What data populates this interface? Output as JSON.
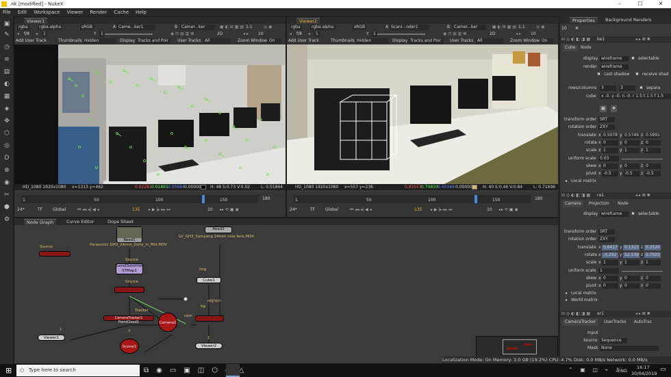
{
  "window": {
    "title": ".nk [modified] - NukeX",
    "minimize": "–",
    "maximize": "☐",
    "close": "✕"
  },
  "menu": [
    "File",
    "Edit",
    "Workspace",
    "Viewer",
    "Render",
    "Cache",
    "Help"
  ],
  "viewer1": {
    "tab": "Viewer1",
    "channels": "rgba",
    "alpha": "rgba.alpha",
    "colorspace": "sRGB",
    "a_label": "A",
    "a_input": "Came...ker1",
    "b_label": "B",
    "b_input": "Camer...ker",
    "fstop": "f/8",
    "frame": "1",
    "y": "Y",
    "y_val": "1",
    "ratio": "1:1",
    "mode": "2D",
    "zoom": "10",
    "add_track": "Add User Track",
    "thumbnails_label": "Thumbnails",
    "thumbnails": "Hidden",
    "display_label": "Display",
    "display": "Tracks and Poir",
    "user_tracks_label": "User Tracks",
    "user_tracks": "All",
    "zoom_window_label": "Zoom Window",
    "zoom_window": "On",
    "format": "HD_1080 1920x1080",
    "coords": "x=1313 y=462",
    "r": "0.02281",
    "g": "0.01891",
    "b": "0.00684",
    "a": "0.00000",
    "hsv": "H: 48 S:0.73 V:0.02",
    "luma": "L: 0.01864"
  },
  "viewer2": {
    "tab": "Viewer2",
    "channels": "rgba",
    "alpha": "rgba.alpha",
    "colorspace": "sRGB",
    "a_label": "A",
    "a_input": "ScanI...nder1",
    "b_label": "B",
    "b_input": "Camer...ker",
    "fstop": "f/8",
    "frame": "1",
    "y": "Y",
    "y_val": "1",
    "ratio": "1:1",
    "mode": "2D",
    "zoom": "10",
    "add_track": "Add User Track",
    "thumbnails_label": "Thumbnails",
    "thumbnails": "Hidden",
    "display_label": "Display",
    "display": "Tracks and Poir",
    "user_tracks_label": "User Tracks",
    "user_tracks": "All",
    "zoom_window_label": "Zoom Window",
    "zoom_window": "On",
    "format": "HD_1080 1920x1080",
    "coords": "x=557 y=236",
    "r": "0.83553",
    "g": "0.70830",
    "b": "0.45346",
    "a": "0.00000",
    "hsv": "H: 40 S:0.46 V:0.84",
    "luma": "L: 0.71696"
  },
  "timeline1": {
    "ticks": [
      "1",
      "50",
      "100",
      "150",
      "180"
    ],
    "fps": "24*",
    "tf": "TF",
    "global": "Global",
    "frame": "135",
    "step": "10"
  },
  "timeline2": {
    "ticks": [
      "1",
      "50",
      "100",
      "150",
      "180"
    ],
    "fps": "24*",
    "tf": "TF",
    "global": "Global",
    "frame": "135",
    "step": "10"
  },
  "graph": {
    "tabs": [
      "Node Graph",
      "Curve Editor",
      "Dope Sheet"
    ],
    "read1_label": "Read1",
    "read1_file": "Panasonic GH3_24mm_Dolly_in_Mid.MOV",
    "read3_label": "Read3",
    "read3_file": "LU_GH3_Samyang 24mm cine lens.MOV",
    "lens": "LensDistortion\nSTMap1",
    "source1": "Source",
    "source2": "Source",
    "source3": "Source",
    "tracker": "Tracker",
    "cameratracker": "CameraTracker1",
    "pointcloud": "PointCloud1",
    "camera1": "Camera1",
    "scene1": "Scene1",
    "cube1": "Cube1",
    "img": "img",
    "objscn": "obj/scn",
    "cam": "cam",
    "bg": "bg",
    "viewer1": "Viewer1",
    "viewer2": "Viewer2",
    "num1": "1",
    "num2": "2",
    "num3": "1"
  },
  "props": {
    "tabs": [
      "Properties",
      "Background Renders"
    ],
    "max": "10",
    "cube": {
      "name": "be1",
      "tabs": [
        "Cube",
        "Node"
      ],
      "display_label": "display",
      "display": "wireframe",
      "selectable": "selectable",
      "render_label": "render",
      "render": "wireframe",
      "cast_shadow": "cast shadow",
      "receive_shadow": "receive shad",
      "rows_label": "rows/columns",
      "rows": "3",
      "cols": "3",
      "separate": "separa",
      "cube_label": "cube",
      "cube_vals": "x -0.  y -0.  n -0.  r 1.5  t 1.5  f 1.5",
      "torder_label": "transform order",
      "torder": "SRT",
      "rorder_label": "rotation order",
      "rorder": "ZXY",
      "translate_label": "translate",
      "tx": "0.5078",
      "ty": "0.5749",
      "tz": "0.5891",
      "rotate_label": "rotate",
      "rx": "0",
      "ry": "0",
      "rz": "0",
      "scale_label": "scale",
      "sx": "1",
      "sy": "1",
      "sz": "1",
      "uscale_label": "uniform scale",
      "uscale": "0.03",
      "skew_label": "skew",
      "kx": "0",
      "ky": "0",
      "kz": "0",
      "pivot_label": "pivot",
      "px": "-0.5",
      "py": "-0.5",
      "pz": "-0.5",
      "local_matrix": "Local matrix"
    },
    "camera": {
      "name": "ra1",
      "tabs": [
        "Camera",
        "Projection",
        "Node"
      ],
      "display_label": "display",
      "display": "wireframe",
      "selectable": "selectable",
      "torder_label": "transform order",
      "torder": "SRT",
      "rorder_label": "rotation order",
      "rorder": "ZXY",
      "translate_label": "translate",
      "tx": "0.6417",
      "ty": "0.1323",
      "tz": "0.2520",
      "rotate_label": "rotate",
      "rx": "-3.292",
      "ry": "52.539",
      "rz": "0.7503",
      "scale_label": "scale",
      "sx": "1",
      "sy": "1",
      "sz": "1",
      "uscale_label": "uniform scale",
      "uscale": "1",
      "skew_label": "skew",
      "kx": "0",
      "ky": "0",
      "kz": "0",
      "pivot_label": "pivot",
      "px": "0",
      "py": "0",
      "pz": "0",
      "local_matrix": "Local matrix",
      "world_matrix": "World matrix"
    },
    "ctracker": {
      "name": "er1",
      "tabs": [
        "CameraTracker",
        "UserTracks",
        "AutoTrac"
      ],
      "input_label": "Input",
      "source_label": "Source",
      "source": "Sequence",
      "mask_label": "Mask",
      "mask": "None"
    }
  },
  "statusline": "Localization Mode: On  Memory: 3.0 GB (19.2%)  CPU: 4.7%  Disk: 0.0 MB/s  Network: 0.0 MB/s",
  "taskbar": {
    "search": "Type here to search",
    "time": "16:17",
    "date": "30/04/2019",
    "lang": "ENG"
  }
}
